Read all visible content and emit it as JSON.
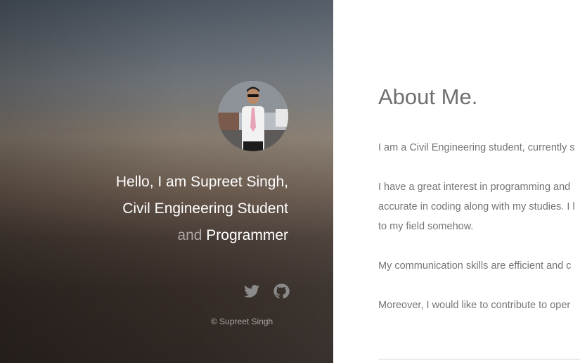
{
  "sidebar": {
    "greeting_line1": "Hello, I am Supreet Singh,",
    "greeting_line2": "Civil Engineering Student",
    "greeting_and": "and",
    "greeting_role": "Programmer",
    "copyright": "© Supreet Singh",
    "social": [
      {
        "icon": "twitter-icon"
      },
      {
        "icon": "github-icon"
      }
    ]
  },
  "main": {
    "title": "About Me.",
    "paragraphs": [
      [
        "I am a Civil Engineering student, currently s"
      ],
      [
        "I have a great interest in programming and",
        "accurate in coding along with my studies. I l",
        "to my field somehow."
      ],
      [
        "My communication skills are efficient and c"
      ],
      [
        "Moreover, I would like to contribute to oper"
      ]
    ]
  },
  "colors": {
    "heading": "#6f6f6f",
    "body_text": "#757575",
    "sidebar_text": "#ffffff"
  }
}
